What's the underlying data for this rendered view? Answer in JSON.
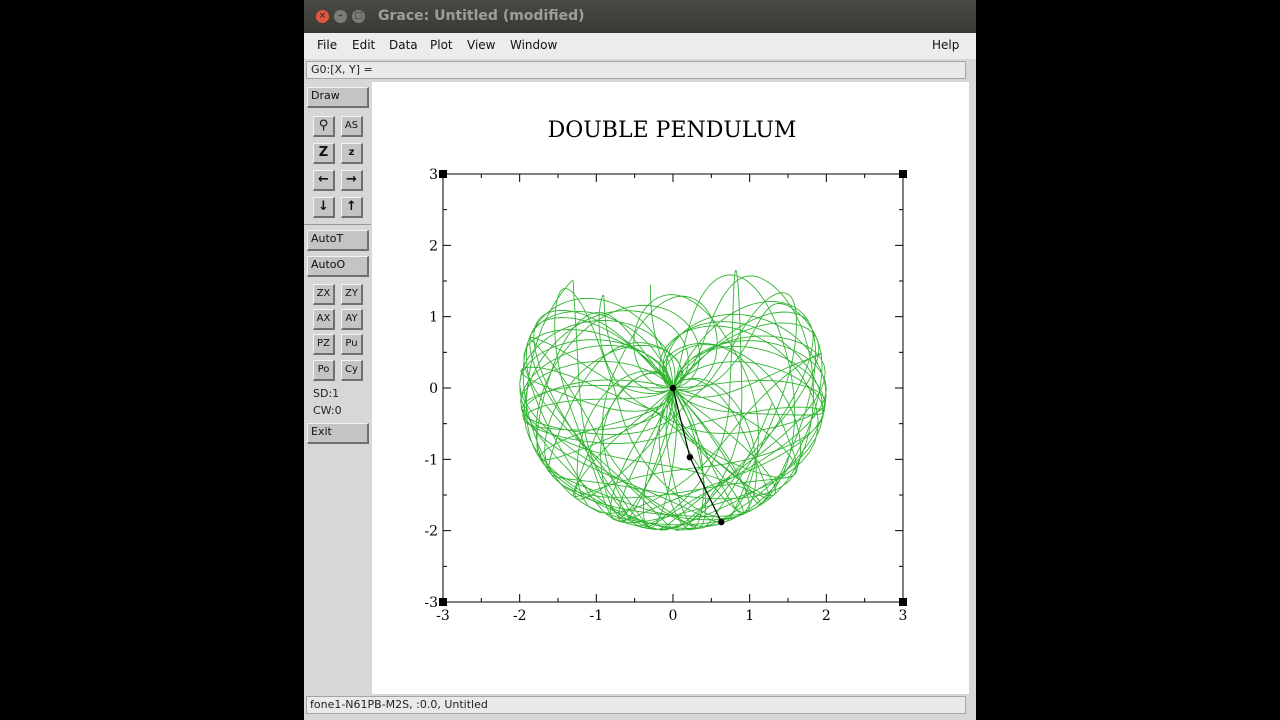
{
  "window": {
    "title": "Grace: Untitled (modified)"
  },
  "menu": [
    "File",
    "Edit",
    "Data",
    "Plot",
    "View",
    "Window"
  ],
  "help_label": "Help",
  "locator": "G0:[X, Y] =",
  "toolbar": {
    "draw": "Draw",
    "autot": "AutoT",
    "autoo": "AutoO",
    "zx": "ZX",
    "zy": "ZY",
    "ax": "AX",
    "ay": "AY",
    "pz": "PZ",
    "pu": "Pu",
    "po": "Po",
    "cy": "Cy",
    "sd": "SD:1",
    "cw": "CW:0",
    "exit": "Exit",
    "icons": [
      "zoom-icon",
      "autoscale-icon",
      "zoom-in-icon",
      "zoom-out-icon",
      "left-arrow-icon",
      "right-arrow-icon",
      "down-arrow-icon",
      "up-arrow-icon"
    ]
  },
  "status": "fone1-N61PB-M2S, :0.0, Untitled",
  "chart_data": {
    "type": "line",
    "title": "DOUBLE PENDULUM",
    "xlabel": "",
    "ylabel": "",
    "xlim": [
      -3,
      3
    ],
    "ylim": [
      -3,
      3
    ],
    "x_ticks": [
      "-3",
      "-2",
      "-1",
      "0",
      "1",
      "2",
      "3"
    ],
    "y_ticks": [
      "-3",
      "-2",
      "-1",
      "0",
      "1",
      "2",
      "3"
    ],
    "series": [
      {
        "color": "#32b432",
        "description": "trajectory of lower bob (bounded by radius 2)"
      },
      {
        "color": "#000000",
        "points": [
          [
            0,
            0
          ],
          [
            0.22,
            -0.97
          ],
          [
            0.63,
            -1.88
          ]
        ]
      }
    ]
  }
}
